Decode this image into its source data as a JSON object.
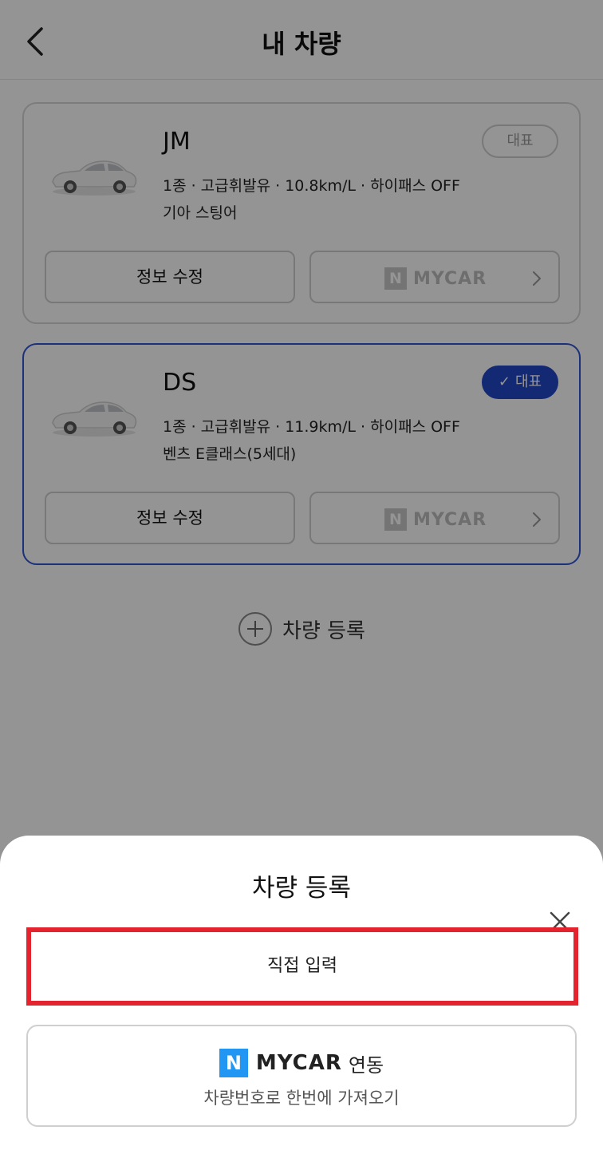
{
  "header": {
    "title": "내 차량"
  },
  "cars": [
    {
      "name": "JM",
      "spec": "1종 · 고급휘발유 · 10.8km/L · 하이패스 OFF",
      "model": "기아 스팅어",
      "representative": false,
      "rep_label": "대표",
      "edit_label": "정보 수정",
      "mycar_label": "MYCAR",
      "mycar_n": "N"
    },
    {
      "name": "DS",
      "spec": "1종 · 고급휘발유 · 11.9km/L · 하이패스 OFF",
      "model": "벤츠 E클래스(5세대)",
      "representative": true,
      "rep_label": "대표",
      "edit_label": "정보 수정",
      "mycar_label": "MYCAR",
      "mycar_n": "N"
    }
  ],
  "add_car": {
    "label": "차량 등록"
  },
  "sheet": {
    "title": "차량 등록",
    "manual_input": "직접 입력",
    "mycar_n": "N",
    "mycar_brand": "MYCAR",
    "mycar_link_word": "연동",
    "mycar_subtitle": "차량번호로 한번에 가져오기"
  },
  "colors": {
    "accent": "#2347c8",
    "highlight_border": "#e3232d",
    "naver_blue": "#2196f3"
  }
}
